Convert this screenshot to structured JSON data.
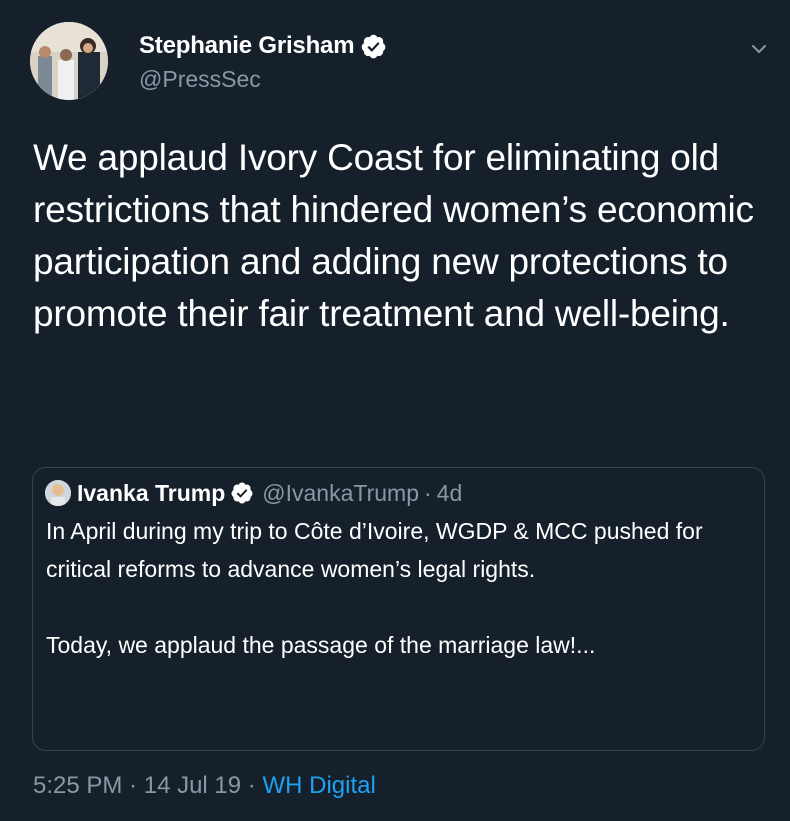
{
  "author": {
    "name": "Stephanie Grisham",
    "handle": "@PressSec",
    "verified_icon": "verified-badge-icon",
    "avatar": "profile-photo"
  },
  "menu_icon": "chevron-down-icon",
  "tweet": {
    "text": "We applaud Ivory Coast for eliminating old restrictions that hindered women’s economic participation and adding new protections to promote their fair treatment and well-being."
  },
  "quote": {
    "name": "Ivanka Trump",
    "handle": "@IvankaTrump",
    "separator": "·",
    "time": "4d",
    "text": "In April during my trip to Côte d’Ivoire, WGDP & MCC pushed for critical reforms to advance women’s legal rights.\n\nToday, we applaud the passage of the marriage law!..."
  },
  "meta": {
    "time": "5:25 PM",
    "separator1": " · ",
    "date": "14 Jul 19",
    "separator2": " · ",
    "source": "WH Digital"
  },
  "colors": {
    "background": "#15202b",
    "text": "#ffffff",
    "secondary": "#8899a6",
    "accent": "#1da1f2",
    "border": "#38444d"
  }
}
